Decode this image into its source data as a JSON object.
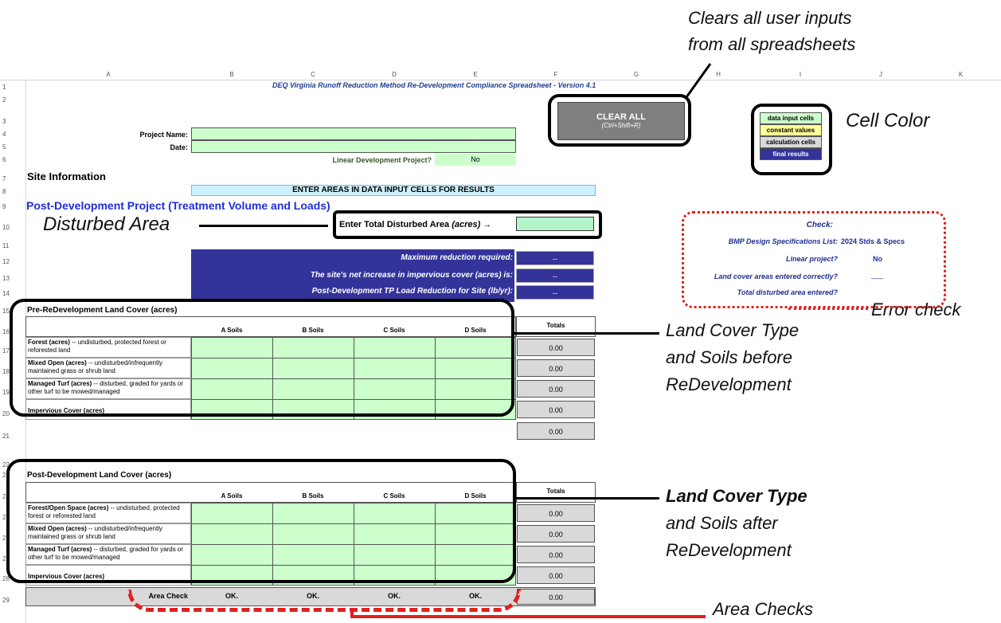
{
  "annotations": {
    "clear_all": [
      "Clears all user inputs",
      "from all spreadsheets"
    ],
    "cell_color": "Cell Color",
    "disturbed_area": "Disturbed Area",
    "error_check": "Error check",
    "land_before": [
      "Land Cover Type",
      "and Soils before",
      "ReDevelopment"
    ],
    "land_after": [
      "Land Cover Type",
      "and Soils after",
      "ReDevelopment"
    ],
    "area_checks": "Area Checks"
  },
  "columns": [
    "A",
    "B",
    "C",
    "D",
    "E",
    "F",
    "G",
    "H",
    "I",
    "J",
    "K"
  ],
  "rows": [
    "1",
    "2",
    "3",
    "4",
    "5",
    "6",
    "7",
    "8",
    "9",
    "10",
    "11",
    "12",
    "13",
    "14",
    "15",
    "16",
    "17",
    "18",
    "19",
    "20",
    "21",
    "22",
    "23",
    "24",
    "25",
    "26",
    "27",
    "28",
    "29"
  ],
  "title": "DEQ Virginia Runoff Reduction Method Re-Development Compliance Spreadsheet  - Version 4.1",
  "clear_all_button": {
    "label": "CLEAR ALL",
    "shortcut": "(Ctrl+Shift+R)"
  },
  "project": {
    "name_label": "Project Name:",
    "date_label": "Date:",
    "linear_label": "Linear Development Project?",
    "linear_value": "No"
  },
  "site_info": "Site Information",
  "enter_areas_banner": "ENTER AREAS IN DATA INPUT CELLS FOR RESULTS",
  "post_dev_heading": "Post-Development Project (Treatment Volume and Loads)",
  "disturbed_label": "Enter Total Disturbed Area",
  "disturbed_unit": "(acres)",
  "disturbed_arrow": "→",
  "results": [
    {
      "label": "Maximum reduction required:",
      "value": "--"
    },
    {
      "label": "The site's net increase in impervious cover (acres) is:",
      "value": "--"
    },
    {
      "label": "Post-Development TP Load Reduction for Site (lb/yr):",
      "value": "--"
    }
  ],
  "legend": {
    "items": [
      "data input cells",
      "constant values",
      "calculation cells",
      "final results"
    ],
    "colors": [
      "#ccffcc",
      "#ffff99",
      "#d9d9d9",
      "#333399"
    ]
  },
  "check": {
    "title": "Check:",
    "rows": [
      {
        "label": "BMP Design Specifications List:",
        "value": "2024 Stds & Specs"
      },
      {
        "label": "Linear project?",
        "value": "No"
      },
      {
        "label": "Land cover areas entered correctly?",
        "value": "___"
      },
      {
        "label": "Total disturbed area entered?",
        "value": ""
      }
    ]
  },
  "pre_table": {
    "title": "Pre-ReDevelopment Land Cover  (acres)",
    "soils": [
      "A Soils",
      "B Soils",
      "C Soils",
      "D Soils"
    ],
    "totals_label": "Totals",
    "rows": [
      {
        "bold": "Forest (acres)",
        "rest": " -- undisturbed, protected forest or reforested land",
        "total": "0.00"
      },
      {
        "bold": "Mixed Open (acres)",
        "rest": " -- undisturbed/infrequently maintained grass or shrub land",
        "total": "0.00"
      },
      {
        "bold": "Managed Turf (acres)",
        "rest": " -- disturbed, graded for yards or other turf to be mowed/managed",
        "total": "0.00"
      },
      {
        "bold": "Impervious Cover (acres)",
        "rest": "",
        "total": "0.00"
      }
    ],
    "grand_total": "0.00"
  },
  "post_table": {
    "title": "Post-Development Land Cover  (acres)",
    "soils": [
      "A Soils",
      "B Soils",
      "C Soils",
      "D Soils"
    ],
    "totals_label": "Totals",
    "rows": [
      {
        "bold": "Forest/Open Space (acres)",
        "rest": " -- undisturbed, protected forest or reforested land",
        "total": "0.00"
      },
      {
        "bold": "Mixed Open (acres)",
        "rest": " -- undisturbed/infrequently maintained grass or shrub land",
        "total": "0.00"
      },
      {
        "bold": "Managed Turf (acres)",
        "rest": " -- disturbed, graded for yards or other turf to be mowed/managed",
        "total": "0.00"
      },
      {
        "bold": "Impervious Cover (acres)",
        "rest": "",
        "total": "0.00"
      }
    ],
    "area_check_label": "Area Check",
    "area_check_values": [
      "OK.",
      "OK.",
      "OK.",
      "OK."
    ],
    "area_check_total": "0.00"
  }
}
